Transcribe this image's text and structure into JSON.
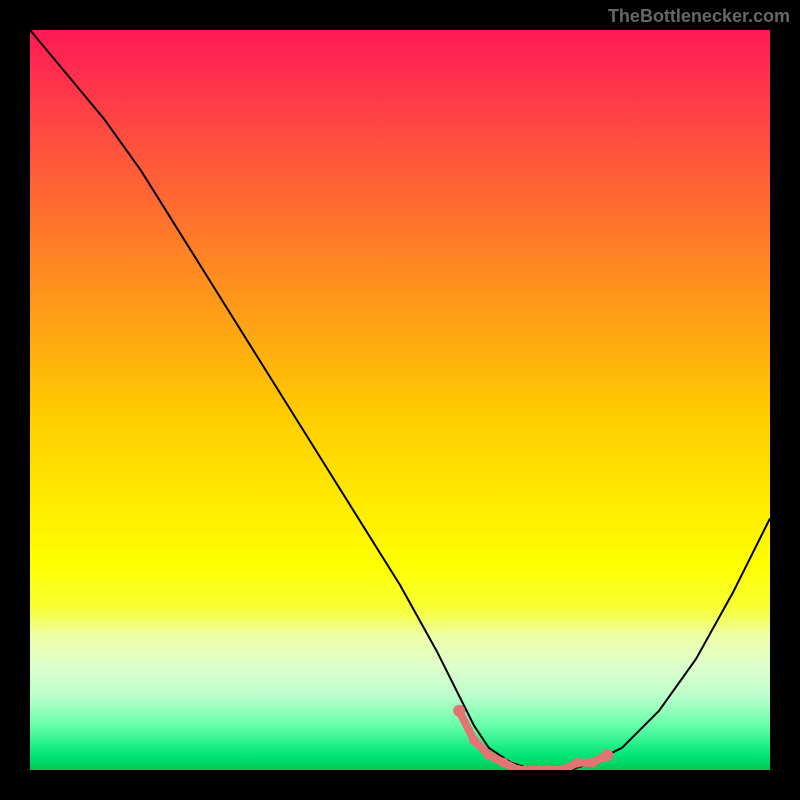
{
  "watermark": "TheBottlenecker.com",
  "chart_data": {
    "type": "line",
    "title": "",
    "xlabel": "",
    "ylabel": "",
    "xlim": [
      0,
      100
    ],
    "ylim": [
      0,
      100
    ],
    "series": [
      {
        "name": "bottleneck-curve",
        "x": [
          0,
          5,
          10,
          15,
          20,
          25,
          30,
          35,
          40,
          45,
          50,
          55,
          58,
          60,
          62,
          65,
          68,
          70,
          73,
          76,
          80,
          85,
          90,
          95,
          100
        ],
        "y": [
          100,
          94,
          88,
          81,
          73,
          65,
          57,
          49,
          41,
          33,
          25,
          16,
          10,
          6,
          3,
          1,
          0,
          0,
          0,
          1,
          3,
          8,
          15,
          24,
          34
        ]
      }
    ],
    "markers": {
      "name": "highlight-range",
      "color": "#e57373",
      "x": [
        58,
        60,
        62,
        64,
        66,
        68,
        70,
        72,
        74,
        76,
        78
      ],
      "y": [
        8,
        4,
        2,
        1,
        0,
        0,
        0,
        0,
        1,
        1,
        2
      ]
    }
  }
}
